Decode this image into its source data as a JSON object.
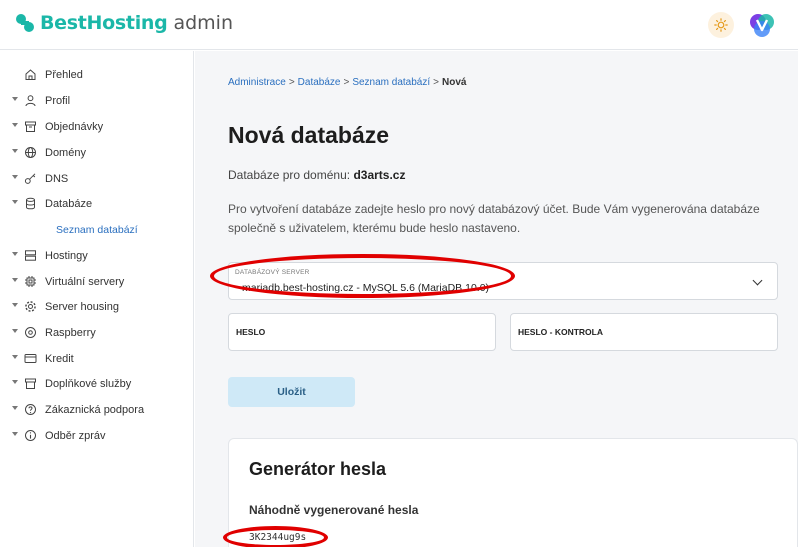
{
  "header": {
    "brand": "BestHosting",
    "suffix": "admin",
    "brand_color": "#1bb7a8"
  },
  "sidebar": {
    "items": [
      {
        "label": "Přehled",
        "icon": "home-icon"
      },
      {
        "label": "Profil",
        "icon": "user-icon"
      },
      {
        "label": "Objednávky",
        "icon": "archive-icon"
      },
      {
        "label": "Domény",
        "icon": "globe-icon"
      },
      {
        "label": "DNS",
        "icon": "key-icon"
      },
      {
        "label": "Databáze",
        "icon": "database-icon"
      },
      {
        "label": "Hostingy",
        "icon": "server-icon"
      },
      {
        "label": "Virtuální servery",
        "icon": "chip-icon"
      },
      {
        "label": "Server housing",
        "icon": "gear-icon"
      },
      {
        "label": "Raspberry",
        "icon": "target-icon"
      },
      {
        "label": "Kredit",
        "icon": "credit-card-icon"
      },
      {
        "label": "Doplňkové služby",
        "icon": "box-icon"
      },
      {
        "label": "Zákaznická podpora",
        "icon": "help-icon"
      },
      {
        "label": "Odběr zpráv",
        "icon": "info-icon"
      }
    ],
    "sub_item": "Seznam databází"
  },
  "breadcrumb": {
    "items": [
      "Administrace",
      "Databáze",
      "Seznam databází"
    ],
    "separator": ">",
    "current": "Nová"
  },
  "page": {
    "title": "Nová databáze",
    "domain_prefix": "Databáze pro doménu:",
    "domain": "d3arts.cz",
    "description": "Pro vytvoření databáze zadejte heslo pro nový databázový účet. Bude Vám vygenerována databáze společně s uživatelem, kterému bude heslo nastaveno."
  },
  "form": {
    "server_label": "Databázový server",
    "server_value": "mariadb.best-hosting.cz - MySQL 5.6 (MariaDB 10.0)",
    "password_placeholder": "Heslo",
    "password_confirm_placeholder": "Heslo - kontrola",
    "save_label": "Uložit"
  },
  "generator": {
    "title": "Generátor hesla",
    "subtitle": "Náhodně vygenerované hesla",
    "password": "3K2344ug9s"
  },
  "colors": {
    "link": "#2a6fbf",
    "annotation": "#e00000",
    "save_button_bg": "#cfe9f7"
  }
}
